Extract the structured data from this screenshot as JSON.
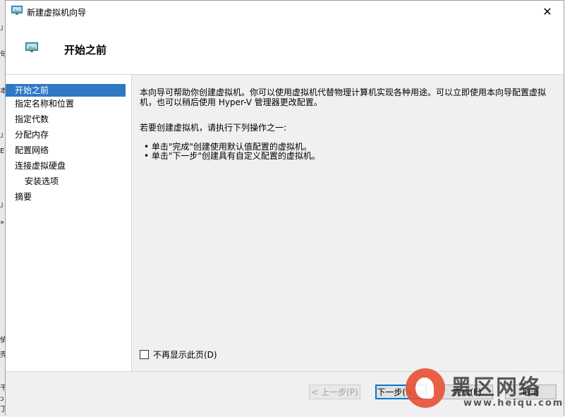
{
  "window": {
    "title": "新建虚拟机向导",
    "close_glyph": "✕"
  },
  "header": {
    "title": "开始之前"
  },
  "nav": {
    "items": [
      {
        "label": "开始之前",
        "active": true
      },
      {
        "label": "指定名称和位置"
      },
      {
        "label": "指定代数"
      },
      {
        "label": "分配内存"
      },
      {
        "label": "配置网络"
      },
      {
        "label": "连接虚拟硬盘"
      },
      {
        "label": "安装选项",
        "sub": true
      },
      {
        "label": "摘要"
      }
    ]
  },
  "content": {
    "paragraph1": "本向导可帮助你创建虚拟机。你可以使用虚拟机代替物理计算机实现各种用途。可以立即使用本向导配置虚拟机，也可以稍后使用 Hyper-V 管理器更改配置。",
    "paragraph2": "若要创建虚拟机，请执行下列操作之一:",
    "bullets": [
      "• 单击\"完成\"创建使用默认值配置的虚拟机。",
      "• 单击\"下一步\"创建具有自定义配置的虚拟机。"
    ]
  },
  "checkbox": {
    "label": "不再显示此页(D)",
    "checked": false
  },
  "footer": {
    "prev_label": "< 上一步(P)",
    "next_label": "下一步(N) >",
    "finish_label": "完成(F)",
    "cancel_label": "取消"
  },
  "watermark": {
    "brand": "黑区网络",
    "url": "www.heiqu.com"
  },
  "background": {
    "glyphs": [
      "」",
      "句",
      "本",
      "」",
      "E",
      "」",
      "»",
      "偵",
      "壳",
      "干",
      "ɔ",
      "丁"
    ]
  },
  "colors": {
    "accent": "#3078c6",
    "primary_border": "#0078d7",
    "watermark_red": "#e8533a"
  }
}
